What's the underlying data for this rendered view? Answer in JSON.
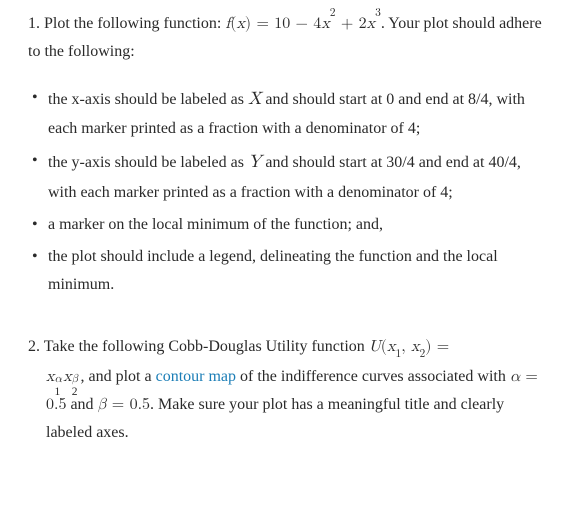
{
  "q1": {
    "number": "1.",
    "lead1": "Plot the following function: ",
    "func_lhs": "f",
    "func_paren_open": "(",
    "func_var": "x",
    "func_paren_close": ")",
    "eq": " = ",
    "rhs_a": "10 − 4",
    "rhs_var1": "x",
    "rhs_exp1": "2",
    "rhs_b": " + 2",
    "rhs_var2": "x",
    "rhs_exp2": "3",
    "lead2": ". Your plot should adhere to the following:",
    "bullets": {
      "b1a": "the x-axis should be labeled as ",
      "b1_var": "X",
      "b1b": " and should start at 0 and end at 8/4, with each marker printed as a fraction with a denominator of 4;",
      "b2a": "the y-axis should be labeled as ",
      "b2_var": "Y",
      "b2b": " and should start at 30/4 and end at 40/4, with each marker printed as a fraction with a denominator of 4;",
      "b3": "a marker on the local minimum of the function; and,",
      "b4": "the plot should include a legend, delineating the function and the local minimum."
    }
  },
  "q2": {
    "number": "2.",
    "lead1": "Take the following Cobb-Douglas Utility function ",
    "U": "U",
    "paren_open": "(",
    "x": "x",
    "one": "1",
    "comma": ", ",
    "two": "2",
    "paren_close": ")",
    "eq": " =",
    "alpha": "α",
    "beta": "β",
    "after_expr": ", and plot a ",
    "link": "contour map",
    "after_link": " of the indifference curves associated with ",
    "eq1_l": "α",
    "eq1_m": " = ",
    "eq1_r": "0.5",
    "and": " and ",
    "eq2_l": "β",
    "eq2_m": " = ",
    "eq2_r": "0.5",
    "tail": ". Make sure your plot has a meaningful title and clearly labeled axes."
  }
}
